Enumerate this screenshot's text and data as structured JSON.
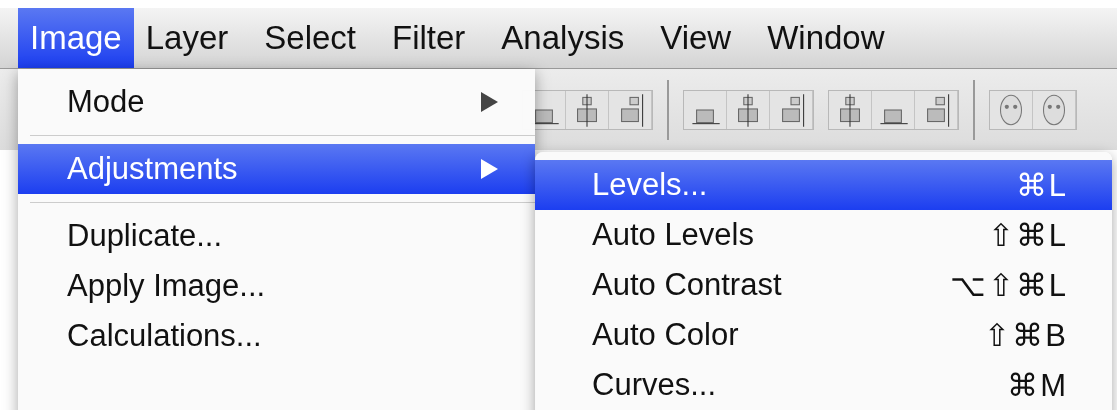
{
  "menubar": [
    {
      "label": "Image",
      "selected": true
    },
    {
      "label": "Layer",
      "selected": false
    },
    {
      "label": "Select",
      "selected": false
    },
    {
      "label": "Filter",
      "selected": false
    },
    {
      "label": "Analysis",
      "selected": false
    },
    {
      "label": "View",
      "selected": false
    },
    {
      "label": "Window",
      "selected": false
    }
  ],
  "menu": {
    "items": [
      {
        "kind": "submenu",
        "label": "Mode",
        "selected": false
      },
      {
        "kind": "separator"
      },
      {
        "kind": "submenu",
        "label": "Adjustments",
        "selected": true
      },
      {
        "kind": "separator"
      },
      {
        "kind": "item",
        "label": "Duplicate...",
        "selected": false
      },
      {
        "kind": "item",
        "label": "Apply Image...",
        "selected": false
      },
      {
        "kind": "item",
        "label": "Calculations...",
        "selected": false
      }
    ]
  },
  "submenu": {
    "items": [
      {
        "label": "Levels...",
        "shortcut": "⌘L",
        "selected": true
      },
      {
        "label": "Auto Levels",
        "shortcut": "⇧⌘L",
        "selected": false
      },
      {
        "label": "Auto Contrast",
        "shortcut": "⌥⇧⌘L",
        "selected": false
      },
      {
        "label": "Auto Color",
        "shortcut": "⇧⌘B",
        "selected": false
      },
      {
        "label": "Curves...",
        "shortcut": "⌘M",
        "selected": false
      }
    ]
  }
}
